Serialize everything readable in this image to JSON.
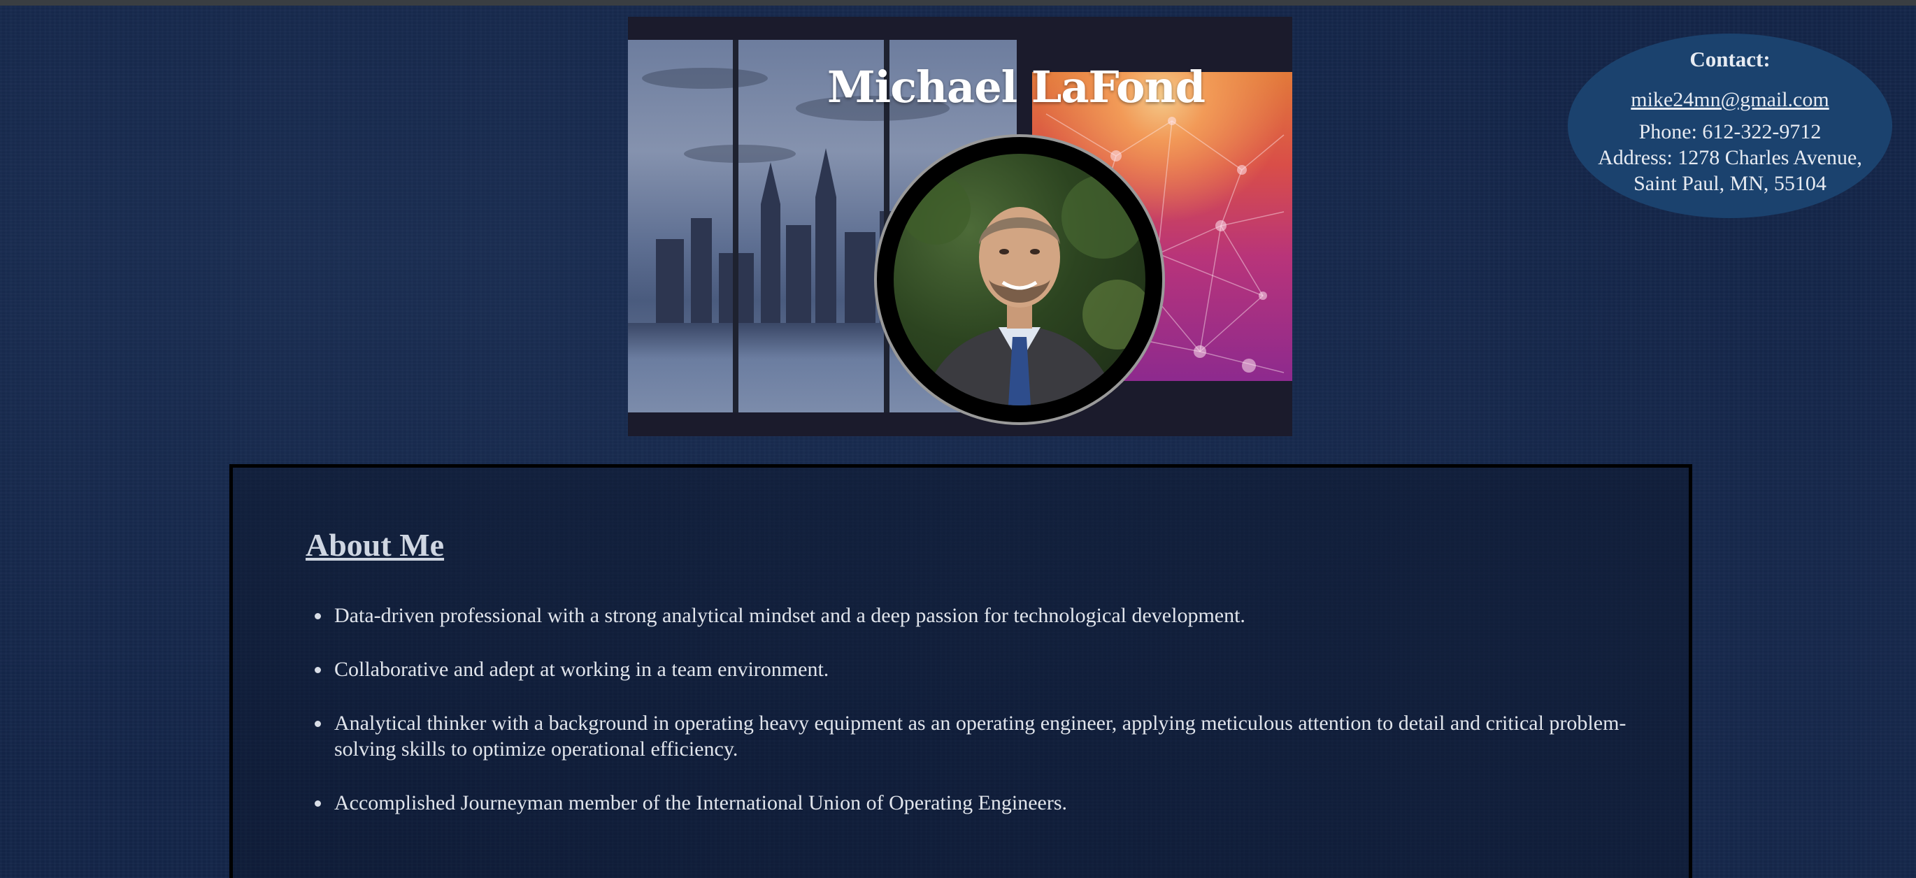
{
  "header": {
    "name": "Michael LaFond"
  },
  "contact": {
    "title": "Contact:",
    "email": "mike24mn@gmail.com",
    "phone": "Phone: 612-322-9712",
    "address": "Address: 1278 Charles Avenue, Saint Paul, MN, 55104"
  },
  "about": {
    "heading": "About Me",
    "items": [
      {
        "text": "Data-driven professional with a strong analytical mindset and a deep passion for technological development."
      },
      {
        "text": "Collaborative and adept at working in a team environment."
      },
      {
        "text": "Analytical thinker with a background in operating heavy equipment as an operating engineer, applying meticulous attention to detail and critical problem-solving skills to optimize operational efficiency."
      },
      {
        "text": "Accomplished Journeyman member of the International Union of Operating Engineers."
      }
    ]
  },
  "colors": {
    "page_background": "#14264a",
    "contact_bubble": "#1b426e",
    "about_border": "#000000",
    "heading_text": "#cfd6e2",
    "body_text": "#e1e5ec"
  }
}
